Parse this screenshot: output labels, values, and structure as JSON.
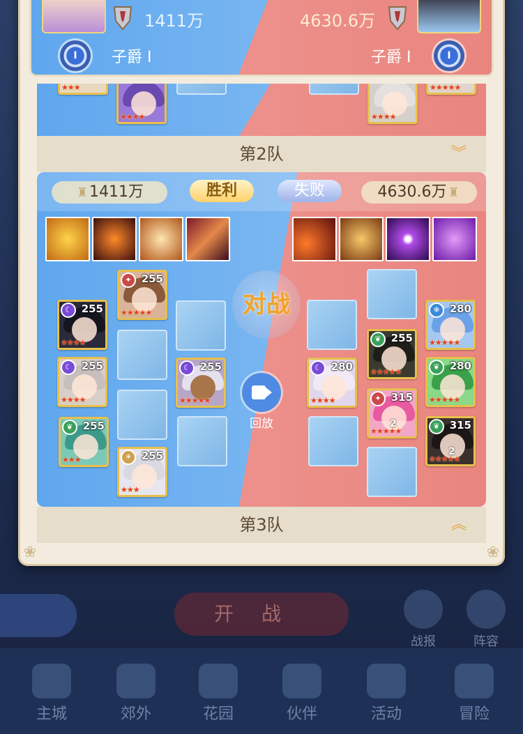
{
  "background_nav": {
    "items": [
      "主城",
      "郊外",
      "花园",
      "伙伴",
      "活动",
      "冒险"
    ],
    "side_buttons": [
      "战报",
      "阵容"
    ],
    "start_button": "开战"
  },
  "header": {
    "left_power": "1411万",
    "right_power": "4630.6万",
    "left_rank": "子爵 I",
    "right_rank": "子爵 I",
    "rank_badge": "I"
  },
  "teams": {
    "team2_label": "第2队",
    "team3_label": "第3队"
  },
  "battle": {
    "left_power": "1411万",
    "right_power": "4630.6万",
    "left_result": "胜利",
    "right_result": "失败",
    "vs_label": "对战",
    "replay_label": "回放",
    "left_heroes": [
      {
        "level": "255",
        "tag": ""
      },
      {
        "level": "255",
        "tag": ""
      },
      {
        "level": "255",
        "tag": ""
      },
      {
        "level": "255",
        "tag": ""
      },
      {
        "level": "255",
        "tag": ""
      },
      {
        "level": "255",
        "tag": ""
      }
    ],
    "right_heroes": [
      {
        "level": "280",
        "tag": ""
      },
      {
        "level": "280",
        "tag": ""
      },
      {
        "level": "255",
        "tag": ""
      },
      {
        "level": "280",
        "tag": ""
      },
      {
        "level": "315",
        "tag": "2"
      },
      {
        "level": "315",
        "tag": "2"
      }
    ]
  },
  "colors": {
    "blue_side": "#6aaef0",
    "red_side": "#ee8a86",
    "gold_frame": "#e9c04c",
    "panel_bg": "#f3ecde"
  }
}
